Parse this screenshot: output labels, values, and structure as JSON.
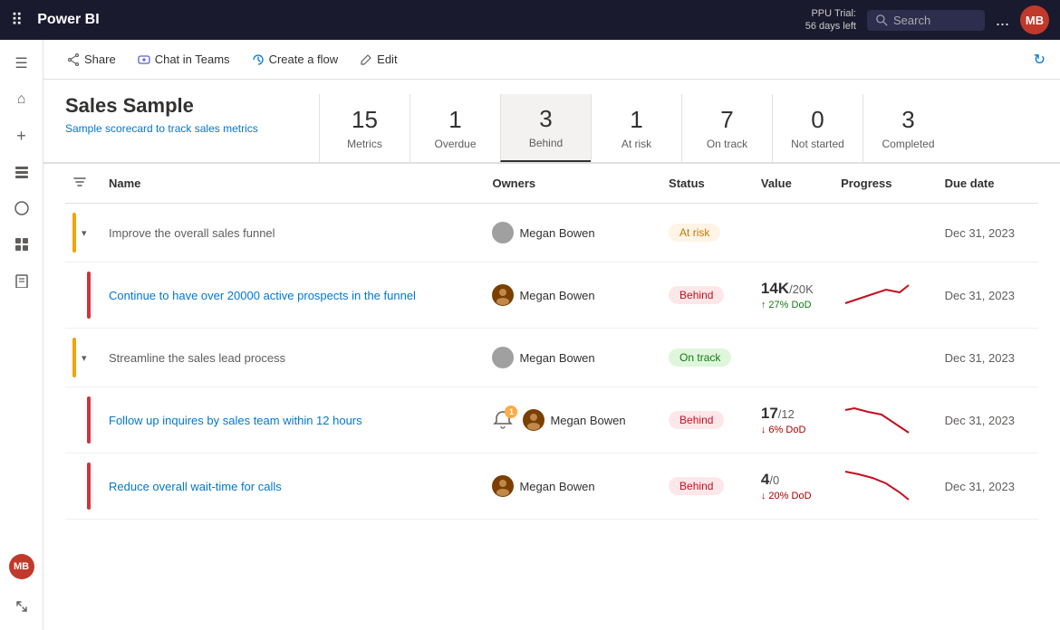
{
  "topNav": {
    "appName": "Power BI",
    "trial": "PPU Trial:\n56 days left",
    "searchPlaceholder": "Search",
    "moreLabel": "...",
    "avatarInitials": "MB"
  },
  "actionBar": {
    "shareLabel": "Share",
    "chatLabel": "Chat in Teams",
    "createFlowLabel": "Create a flow",
    "editLabel": "Edit"
  },
  "scorecard": {
    "title": "Sales Sample",
    "subtitle": "Sample scorecard to track sales metrics",
    "metrics": [
      {
        "num": "15",
        "label": "Metrics"
      },
      {
        "num": "1",
        "label": "Overdue"
      },
      {
        "num": "3",
        "label": "Behind"
      },
      {
        "num": "1",
        "label": "At risk"
      },
      {
        "num": "7",
        "label": "On track"
      },
      {
        "num": "0",
        "label": "Not started"
      },
      {
        "num": "3",
        "label": "Completed"
      }
    ],
    "activeMetricIndex": 2
  },
  "tableHeaders": {
    "filter": "filter",
    "name": "Name",
    "owners": "Owners",
    "status": "Status",
    "value": "Value",
    "progress": "Progress",
    "dueDate": "Due date"
  },
  "rows": [
    {
      "id": "row1",
      "type": "parent",
      "indent": false,
      "barColor": "orange",
      "name": "Improve the overall sales funnel",
      "owners": [
        {
          "name": "Megan Bowen",
          "type": "avatar"
        }
      ],
      "status": "At risk",
      "statusClass": "status-at-risk",
      "value": "",
      "targetValue": "",
      "dod": "",
      "dodClass": "",
      "dueDate": "Dec 31, 2023",
      "hasChildren": true,
      "hasChart": false
    },
    {
      "id": "row2",
      "type": "child",
      "indent": true,
      "barColor": "red",
      "name": "Continue to have over 20000 active prospects in the funnel",
      "owners": [
        {
          "name": "Megan Bowen",
          "type": "avatar"
        }
      ],
      "status": "Behind",
      "statusClass": "status-behind",
      "value": "14K",
      "targetValue": "/20K",
      "dod": "↑ 27% DoD",
      "dodClass": "up",
      "dueDate": "Dec 31, 2023",
      "hasChildren": false,
      "hasChart": true,
      "chartType": "up"
    },
    {
      "id": "row3",
      "type": "parent",
      "indent": false,
      "barColor": "orange",
      "name": "Streamline the sales lead process",
      "owners": [
        {
          "name": "Megan Bowen",
          "type": "avatar-gray"
        }
      ],
      "status": "On track",
      "statusClass": "status-on-track",
      "value": "",
      "targetValue": "",
      "dod": "",
      "dodClass": "",
      "dueDate": "Dec 31, 2023",
      "hasChildren": true,
      "hasChart": false
    },
    {
      "id": "row4",
      "type": "child",
      "indent": true,
      "barColor": "red",
      "name": "Follow up inquires by sales team within 12 hours",
      "owners": [
        {
          "name": "Megan Bowen",
          "type": "avatar"
        }
      ],
      "status": "Behind",
      "statusClass": "status-behind",
      "value": "17",
      "targetValue": "/12",
      "dod": "↓ 6% DoD",
      "dodClass": "down",
      "dueDate": "Dec 31, 2023",
      "hasChildren": false,
      "hasChart": true,
      "chartType": "down",
      "hasNotif": true,
      "notifCount": "1"
    },
    {
      "id": "row5",
      "type": "child",
      "indent": true,
      "barColor": "red",
      "name": "Reduce overall wait-time for calls",
      "owners": [
        {
          "name": "Megan Bowen",
          "type": "avatar"
        }
      ],
      "status": "Behind",
      "statusClass": "status-behind",
      "value": "4",
      "targetValue": "/0",
      "dod": "↓ 20% DoD",
      "dodClass": "down",
      "dueDate": "Dec 31, 2023",
      "hasChildren": false,
      "hasChart": true,
      "chartType": "down2"
    }
  ],
  "leftNav": {
    "items": [
      {
        "icon": "☰",
        "name": "menu"
      },
      {
        "icon": "⌂",
        "name": "home"
      },
      {
        "icon": "+",
        "name": "create"
      },
      {
        "icon": "❑",
        "name": "browse"
      },
      {
        "icon": "◯",
        "name": "apps"
      },
      {
        "icon": "⊞",
        "name": "scorecard"
      },
      {
        "icon": "📖",
        "name": "learn"
      },
      {
        "icon": "⊡",
        "name": "metrics"
      }
    ]
  }
}
